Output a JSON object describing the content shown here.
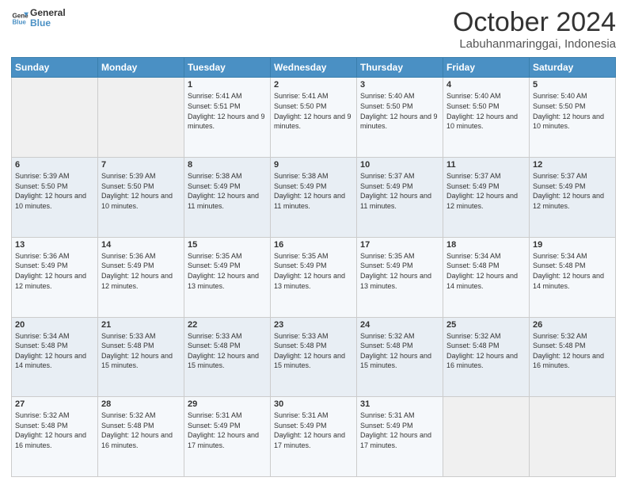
{
  "header": {
    "logo_line1": "General",
    "logo_line2": "Blue",
    "main_title": "October 2024",
    "subtitle": "Labuhanmaringgai, Indonesia"
  },
  "days_of_week": [
    "Sunday",
    "Monday",
    "Tuesday",
    "Wednesday",
    "Thursday",
    "Friday",
    "Saturday"
  ],
  "weeks": [
    [
      {
        "day": "",
        "info": ""
      },
      {
        "day": "",
        "info": ""
      },
      {
        "day": "1",
        "sunrise": "5:41 AM",
        "sunset": "5:51 PM",
        "daylight": "12 hours and 9 minutes."
      },
      {
        "day": "2",
        "sunrise": "5:41 AM",
        "sunset": "5:50 PM",
        "daylight": "12 hours and 9 minutes."
      },
      {
        "day": "3",
        "sunrise": "5:40 AM",
        "sunset": "5:50 PM",
        "daylight": "12 hours and 9 minutes."
      },
      {
        "day": "4",
        "sunrise": "5:40 AM",
        "sunset": "5:50 PM",
        "daylight": "12 hours and 10 minutes."
      },
      {
        "day": "5",
        "sunrise": "5:40 AM",
        "sunset": "5:50 PM",
        "daylight": "12 hours and 10 minutes."
      }
    ],
    [
      {
        "day": "6",
        "sunrise": "5:39 AM",
        "sunset": "5:50 PM",
        "daylight": "12 hours and 10 minutes."
      },
      {
        "day": "7",
        "sunrise": "5:39 AM",
        "sunset": "5:50 PM",
        "daylight": "12 hours and 10 minutes."
      },
      {
        "day": "8",
        "sunrise": "5:38 AM",
        "sunset": "5:49 PM",
        "daylight": "12 hours and 11 minutes."
      },
      {
        "day": "9",
        "sunrise": "5:38 AM",
        "sunset": "5:49 PM",
        "daylight": "12 hours and 11 minutes."
      },
      {
        "day": "10",
        "sunrise": "5:37 AM",
        "sunset": "5:49 PM",
        "daylight": "12 hours and 11 minutes."
      },
      {
        "day": "11",
        "sunrise": "5:37 AM",
        "sunset": "5:49 PM",
        "daylight": "12 hours and 12 minutes."
      },
      {
        "day": "12",
        "sunrise": "5:37 AM",
        "sunset": "5:49 PM",
        "daylight": "12 hours and 12 minutes."
      }
    ],
    [
      {
        "day": "13",
        "sunrise": "5:36 AM",
        "sunset": "5:49 PM",
        "daylight": "12 hours and 12 minutes."
      },
      {
        "day": "14",
        "sunrise": "5:36 AM",
        "sunset": "5:49 PM",
        "daylight": "12 hours and 12 minutes."
      },
      {
        "day": "15",
        "sunrise": "5:35 AM",
        "sunset": "5:49 PM",
        "daylight": "12 hours and 13 minutes."
      },
      {
        "day": "16",
        "sunrise": "5:35 AM",
        "sunset": "5:49 PM",
        "daylight": "12 hours and 13 minutes."
      },
      {
        "day": "17",
        "sunrise": "5:35 AM",
        "sunset": "5:49 PM",
        "daylight": "12 hours and 13 minutes."
      },
      {
        "day": "18",
        "sunrise": "5:34 AM",
        "sunset": "5:48 PM",
        "daylight": "12 hours and 14 minutes."
      },
      {
        "day": "19",
        "sunrise": "5:34 AM",
        "sunset": "5:48 PM",
        "daylight": "12 hours and 14 minutes."
      }
    ],
    [
      {
        "day": "20",
        "sunrise": "5:34 AM",
        "sunset": "5:48 PM",
        "daylight": "12 hours and 14 minutes."
      },
      {
        "day": "21",
        "sunrise": "5:33 AM",
        "sunset": "5:48 PM",
        "daylight": "12 hours and 15 minutes."
      },
      {
        "day": "22",
        "sunrise": "5:33 AM",
        "sunset": "5:48 PM",
        "daylight": "12 hours and 15 minutes."
      },
      {
        "day": "23",
        "sunrise": "5:33 AM",
        "sunset": "5:48 PM",
        "daylight": "12 hours and 15 minutes."
      },
      {
        "day": "24",
        "sunrise": "5:32 AM",
        "sunset": "5:48 PM",
        "daylight": "12 hours and 15 minutes."
      },
      {
        "day": "25",
        "sunrise": "5:32 AM",
        "sunset": "5:48 PM",
        "daylight": "12 hours and 16 minutes."
      },
      {
        "day": "26",
        "sunrise": "5:32 AM",
        "sunset": "5:48 PM",
        "daylight": "12 hours and 16 minutes."
      }
    ],
    [
      {
        "day": "27",
        "sunrise": "5:32 AM",
        "sunset": "5:48 PM",
        "daylight": "12 hours and 16 minutes."
      },
      {
        "day": "28",
        "sunrise": "5:32 AM",
        "sunset": "5:48 PM",
        "daylight": "12 hours and 16 minutes."
      },
      {
        "day": "29",
        "sunrise": "5:31 AM",
        "sunset": "5:49 PM",
        "daylight": "12 hours and 17 minutes."
      },
      {
        "day": "30",
        "sunrise": "5:31 AM",
        "sunset": "5:49 PM",
        "daylight": "12 hours and 17 minutes."
      },
      {
        "day": "31",
        "sunrise": "5:31 AM",
        "sunset": "5:49 PM",
        "daylight": "12 hours and 17 minutes."
      },
      {
        "day": "",
        "info": ""
      },
      {
        "day": "",
        "info": ""
      }
    ]
  ]
}
